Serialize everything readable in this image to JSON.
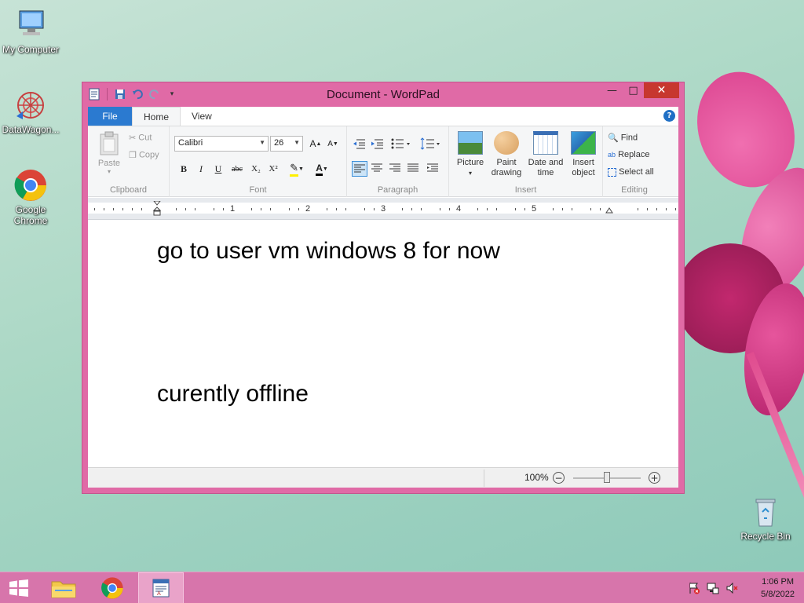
{
  "desktop": {
    "icons": [
      {
        "label": "My Computer"
      },
      {
        "label": "DataWagon..."
      },
      {
        "label": "Google Chrome"
      },
      {
        "label": "Recycle Bin"
      }
    ]
  },
  "window": {
    "title": "Document - WordPad",
    "tabs": {
      "file": "File",
      "home": "Home",
      "view": "View"
    },
    "clipboard": {
      "paste": "Paste",
      "cut": "Cut",
      "copy": "Copy",
      "label": "Clipboard"
    },
    "font": {
      "family": "Calibri",
      "size": "26",
      "label": "Font",
      "bold": "B",
      "italic": "I",
      "underline": "U",
      "strike": "abc",
      "subscript": "X₂",
      "superscript": "X²"
    },
    "paragraph": {
      "label": "Paragraph"
    },
    "insert": {
      "picture": "Picture",
      "paint_line1": "Paint",
      "paint_line2": "drawing",
      "datetime_line1": "Date and",
      "datetime_line2": "time",
      "object_line1": "Insert",
      "object_line2": "object",
      "label": "Insert"
    },
    "editing": {
      "find": "Find",
      "replace": "Replace",
      "select_all": "Select all",
      "label": "Editing"
    },
    "ruler": [
      "1",
      "2",
      "3",
      "4",
      "5"
    ],
    "document": {
      "line1": "go to user vm windows 8 for now",
      "line2": "curently offline"
    },
    "status": {
      "zoom": "100%",
      "zoom_level_percent": 100
    }
  },
  "taskbar": {
    "time": "1:06 PM",
    "date": "5/8/2022"
  },
  "colors": {
    "window_frame": "#e06aa6",
    "close_button": "#c7372f",
    "file_tab": "#2b7ad0",
    "taskbar": "#d775ab"
  }
}
